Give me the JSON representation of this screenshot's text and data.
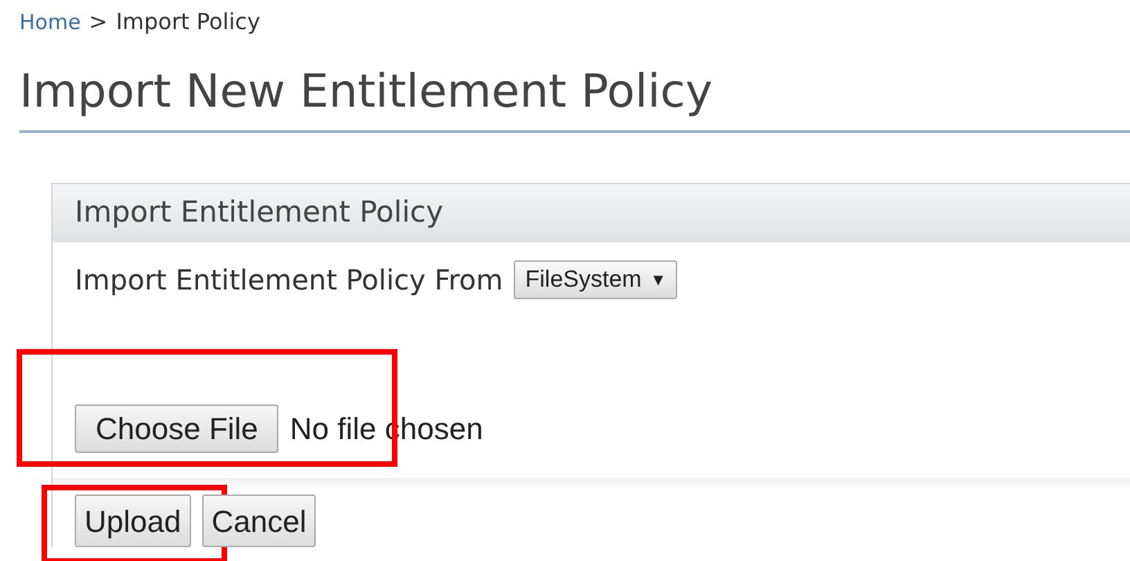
{
  "breadcrumb": [
    {
      "label": "Home",
      "kind": "link"
    },
    {
      "label": ">",
      "kind": "separator"
    },
    {
      "label": "Import Policy",
      "kind": "current"
    }
  ],
  "page_title": "Import New Entitlement Policy",
  "panel": {
    "title": "Import Entitlement Policy",
    "source_label": "Import Entitlement Policy From",
    "source_select": {
      "value": "FileSystem",
      "arrow": "▼"
    },
    "file_input": {
      "button": "Choose File",
      "status": "No file chosen",
      "highlighted": true
    }
  },
  "buttons": [
    {
      "label": "Upload",
      "highlighted": true
    },
    {
      "label": "Cancel",
      "highlighted": false
    }
  ]
}
